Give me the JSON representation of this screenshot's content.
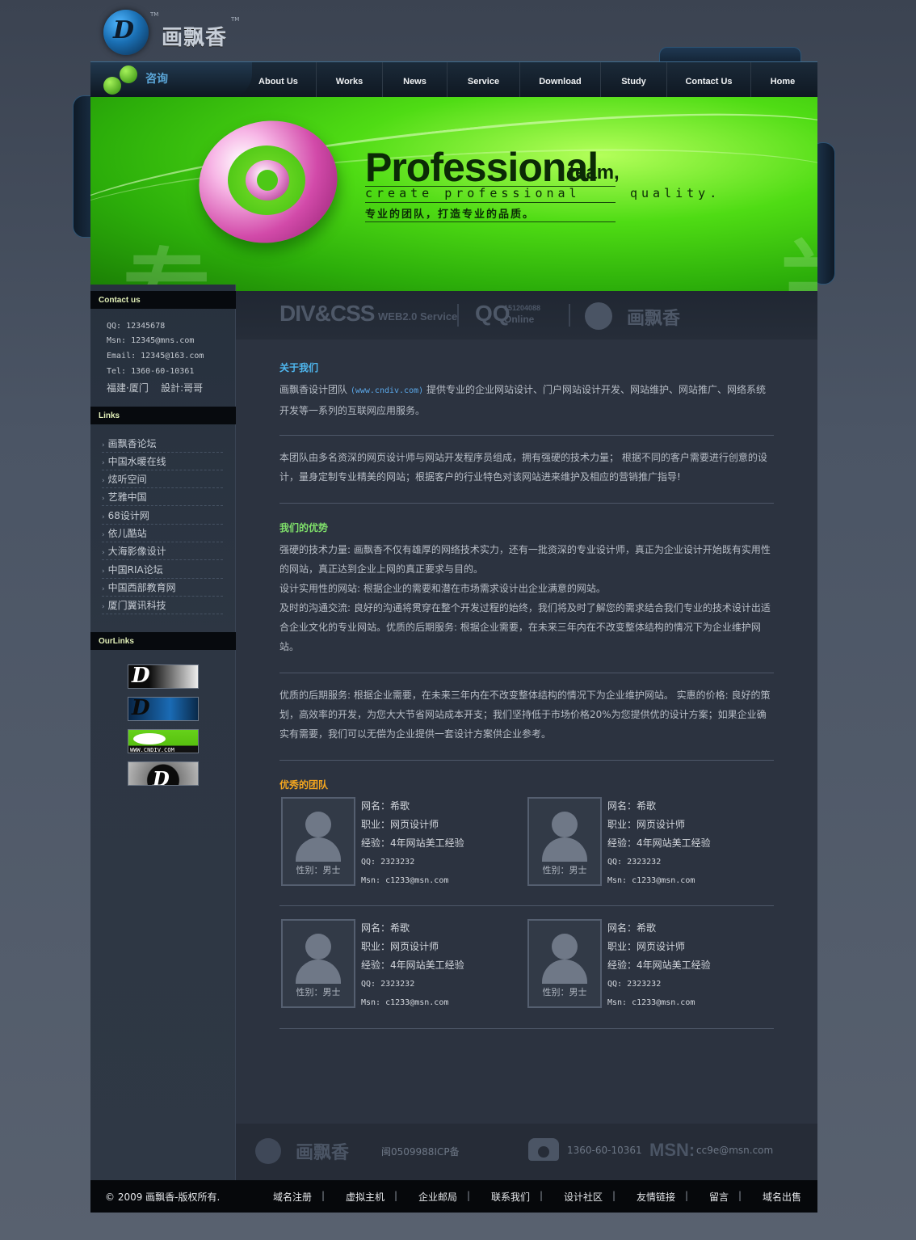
{
  "logo": {
    "mark": "D",
    "name": "画飘香",
    "tm": "TM",
    "icon": "logo-circle-icon"
  },
  "nav": {
    "consult_label": "咨询",
    "items": [
      "About Us",
      "Works",
      "News",
      "Service",
      "Download",
      "Study",
      "Contact Us",
      "Home"
    ]
  },
  "banner": {
    "title": "Professional",
    "title_suffix": "team,",
    "subtitle": "create professional",
    "subtitle2": "quality.",
    "slogan_cn": "专业的团队，打造专业的品质。",
    "bg_char_left": "专",
    "bg_char_right": "兰",
    "icon": "at-sign-icon"
  },
  "sidebar": {
    "contact_title": "Contact us",
    "contact": [
      "QQ: 12345678",
      "Msn: 12345@mns.com",
      "Email: 12345@163.com",
      "Tel: 1360-60-10361",
      "福建·厦门    設計:哥哥"
    ],
    "links_title": "Links",
    "links": [
      "画飘香论坛",
      "中国水暖在线",
      "炫听空间",
      "艺雅中国",
      "68设计网",
      "依儿酷站",
      "大海影像设计",
      "中国RIA论坛",
      "中国西部教育网",
      "厦门翼讯科技"
    ],
    "ourlinks_title": "OurLinks",
    "ourlinks_caption": "WWW.CNDIV.COM"
  },
  "strip": {
    "div_css": "DIV&CSS",
    "web_service": "WEB2.0 Service",
    "qq": "QQ",
    "qq_number": "151204088",
    "online": "Online",
    "logo_name": "画飘香"
  },
  "main": {
    "about_title": "关于我们",
    "about_p1_a": "画飘香设计团队 ",
    "about_url": "(www.cndiv.com)",
    "about_p1_b": " 提供专业的企业网站设计、门户网站设计开发、网站维护、网站推广、网络系统开发等一系列的互联网应用服务。",
    "about_p2": "本团队由多名资深的网页设计师与网站开发程序员组成，拥有强硬的技术力量；  根据不同的客户需要进行创意的设计，量身定制专业精美的网站；根据客户的行业特色对该网站进来维护及相应的营销推广指导!",
    "adv_title": "我们的优势",
    "adv_p": "强硬的技术力量:  画飘香不仅有雄厚的网络技术实力，还有一批资深的专业设计师，真正为企业设计开始既有实用性的网站，真正达到企业上网的真正要求与目的。\n设计实用性的网站:  根据企业的需要和潜在市场需求设计出企业满意的网站。\n及时的沟通交流:  良好的沟通将贯穿在整个开发过程的始终，我们将及时了解您的需求结合我们专业的技术设计出适合企业文化的专业网站。优质的后期服务:  根据企业需要，在未来三年内在不改变整体结构的情况下为企业维护网站。",
    "adv_p2": "优质的后期服务:  根据企业需要，在未来三年内在不改变整体结构的情况下为企业维护网站。  实惠的价格:  良好的策划，高效率的开发，为您大大节省网站成本开支；我们坚持低于市场价格20%为您提供优的设计方案；如果企业确实有需要，我们可以无偿为企业提供一套设计方案供企业参考。",
    "team_title": "优秀的团队",
    "title_colors": {
      "about": "#4fb8f0",
      "adv": "#7fe06a",
      "team": "#f3a51f"
    }
  },
  "team": [
    {
      "gender": "性别：男士",
      "name": "网名：希歌",
      "job": "职业：网页设计师",
      "exp": "经验：4年网站美工经验",
      "qq": "QQ: 2323232",
      "msn": "Msn: c1233@msn.com"
    },
    {
      "gender": "性别：男士",
      "name": "网名：希歌",
      "job": "职业：网页设计师",
      "exp": "经验：4年网站美工经验",
      "qq": "QQ: 2323232",
      "msn": "Msn: c1233@msn.com"
    },
    {
      "gender": "性别：男士",
      "name": "网名：希歌",
      "job": "职业：网页设计师",
      "exp": "经验：4年网站美工经验",
      "qq": "QQ: 2323232",
      "msn": "Msn: c1233@msn.com"
    },
    {
      "gender": "性别：男士",
      "name": "网名：希歌",
      "job": "职业：网页设计师",
      "exp": "经验：4年网站美工经验",
      "qq": "QQ: 2323232",
      "msn": "Msn: c1233@msn.com"
    }
  ],
  "main_footer": {
    "logo_name": "画飘香",
    "icp": "闽0509988ICP备",
    "phone": "1360-60-10361",
    "msn_label": "MSN:",
    "msn": "cc9e@msn.com",
    "phone_icon": "telephone-icon"
  },
  "bottom": {
    "copyright": "© 2009 画飘香-版权所有.",
    "links": [
      "域名注册",
      "虚拟主机",
      "企业邮局",
      "联系我们",
      "设计社区",
      "友情链接",
      "留言",
      "域名出售"
    ]
  }
}
